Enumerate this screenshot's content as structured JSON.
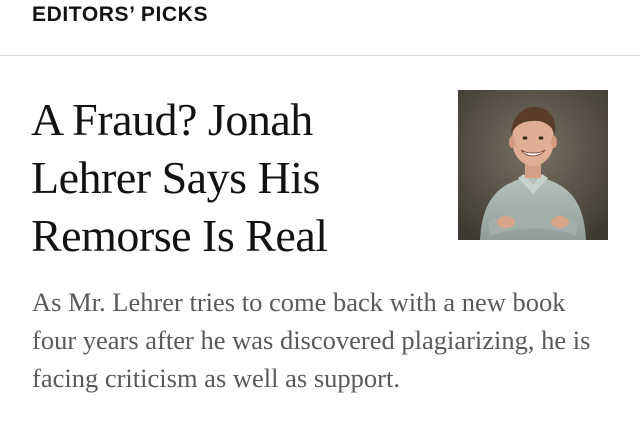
{
  "section": {
    "label": "EDITORS’ PICKS"
  },
  "article": {
    "headline": "A Fraud? Jonah Lehrer Says His Remorse Is Real",
    "summary": "As Mr. Lehrer tries to come back with a new book four years after he was discovered plagiarizing, he is facing criticism as well as support.",
    "image_icon": "portrait-photo"
  }
}
